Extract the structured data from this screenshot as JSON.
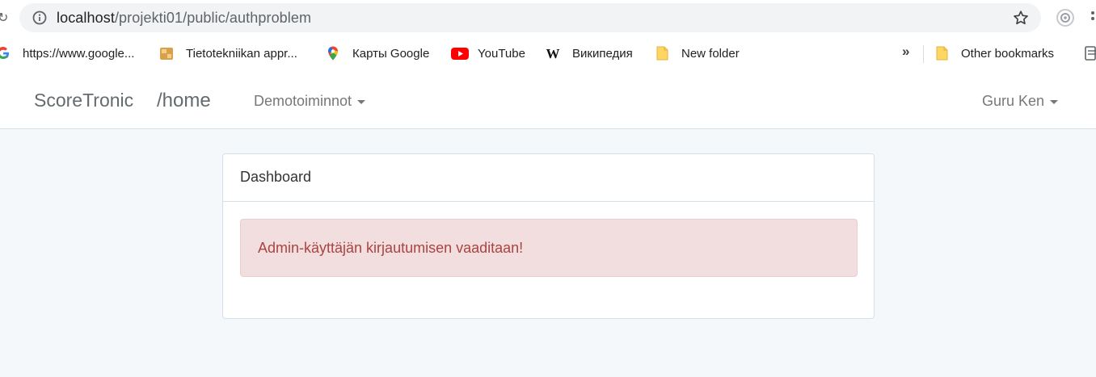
{
  "browser": {
    "url_host": "localhost",
    "url_path": "/projekti01/public/authproblem",
    "bookmarks": [
      {
        "label": "https://www.google...",
        "icon": "google-icon"
      },
      {
        "label": "Tietotekniikan appr...",
        "icon": "puzzle-icon"
      },
      {
        "label": "Карты Google",
        "icon": "maps-pin-icon"
      },
      {
        "label": "YouTube",
        "icon": "youtube-icon"
      },
      {
        "label": "Википедия",
        "icon": "wikipedia-icon"
      },
      {
        "label": "New folder",
        "icon": "folder-icon"
      }
    ],
    "more_label": "»",
    "other_bookmarks": "Other bookmarks"
  },
  "navbar": {
    "brand": "ScoreTronic",
    "path": "/home",
    "menu_label": "Demotoiminnot",
    "user_label": "Guru Ken"
  },
  "card": {
    "title": "Dashboard",
    "alert_message": "Admin-käyttäjän kirjautumisen vaaditaan!"
  },
  "colors": {
    "alert_bg": "#f2dede",
    "alert_text": "#a94442",
    "page_bg": "#f5f8fa"
  }
}
